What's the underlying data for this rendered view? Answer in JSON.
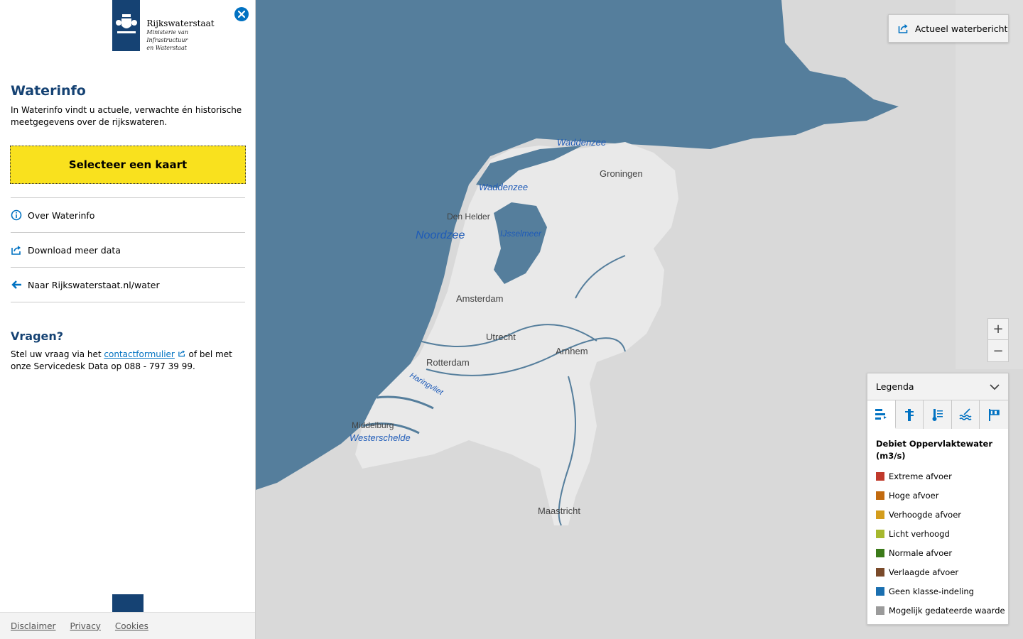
{
  "sidebar": {
    "logo": {
      "title": "Rijkswaterstaat",
      "subtitle_1": "Ministerie van Infrastructuur",
      "subtitle_2": "en Waterstaat"
    },
    "close_icon": "close-icon",
    "title": "Waterinfo",
    "intro": "In Waterinfo vindt u actuele, verwachte én historische meetgegevens over de rijkswateren.",
    "select_button": "Selecteer een kaart",
    "nav": [
      {
        "label": "Over Waterinfo",
        "icon": "info-icon"
      },
      {
        "label": "Download meer data",
        "icon": "export-icon"
      },
      {
        "label": "Naar Rijkswaterstaat.nl/water",
        "icon": "arrow-left-icon"
      }
    ],
    "questions": {
      "title": "Vragen?",
      "text_before": "Stel uw vraag via het ",
      "link": "contactformulier",
      "text_after": " of bel met onze Servicedesk Data op 088 - 797 39 99."
    },
    "footer": {
      "disclaimer": "Disclaimer",
      "privacy": "Privacy",
      "cookies": "Cookies"
    }
  },
  "map": {
    "top_button": "Actueel waterbericht",
    "zoom_in": "+",
    "zoom_out": "−",
    "labels": {
      "waddenzee_1": "Waddenzee",
      "waddenzee_2": "Waddenzee",
      "noordzee": "Noordzee",
      "ijsselmeer": "IJsselmeer",
      "den_helder": "Den Helder",
      "groningen": "Groningen",
      "amsterdam": "Amsterdam",
      "utrecht": "Utrecht",
      "arnhem": "Arnhem",
      "rotterdam": "Rotterdam",
      "haringvliet": "Haringvliet",
      "middelburg": "Middelburg",
      "westerschelde": "Westerschelde",
      "maastricht": "Maastricht"
    }
  },
  "legend": {
    "header": "Legenda",
    "tabs": [
      "discharge-icon",
      "water-level-icon",
      "temperature-icon",
      "waves-icon",
      "wind-flag-icon"
    ],
    "title": "Debiet Oppervlaktewater (m3/s)",
    "items": [
      {
        "label": "Extreme afvoer",
        "color": "#c0392b"
      },
      {
        "label": "Hoge afvoer",
        "color": "#c26a0f"
      },
      {
        "label": "Verhoogde afvoer",
        "color": "#d49d1c"
      },
      {
        "label": "Licht verhoogd",
        "color": "#a6b82e"
      },
      {
        "label": "Normale afvoer",
        "color": "#3b7a19"
      },
      {
        "label": "Verlaagde afvoer",
        "color": "#7a4a2a"
      },
      {
        "label": "Geen klasse-indeling",
        "color": "#1a6fb0"
      },
      {
        "label": "Mogelijk gedateerde waarde",
        "color": "#9b9b9b"
      }
    ]
  }
}
